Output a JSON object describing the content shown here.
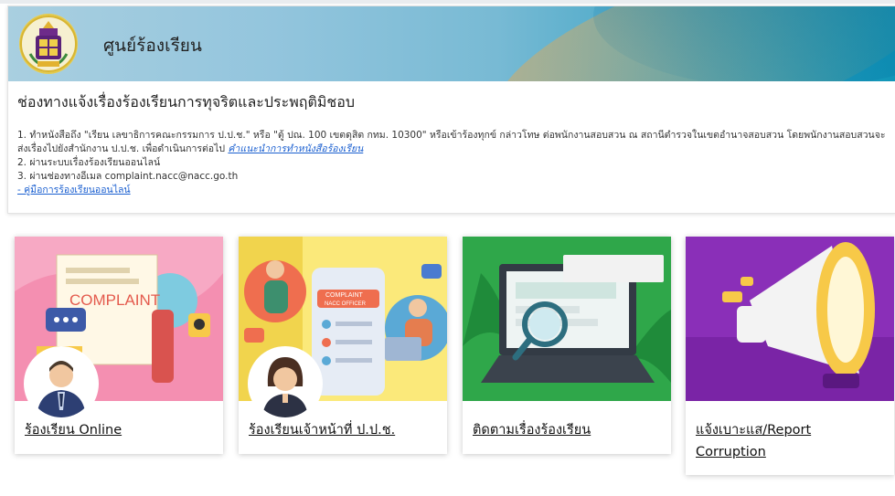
{
  "header": {
    "title": "ศูนย์ร้องเรียน",
    "logo_icon": "nacc-emblem-icon"
  },
  "intro": {
    "heading": "ช่องทางแจ้งเรื่องร้องเรียนการทุจริตและประพฤติมิชอบ",
    "line1": "1. ทำหนังสือถึง \"เรียน เลขาธิการคณะกรรมการ ป.ป.ช.\" หรือ \"ตู้ ปณ. 100 เขตดุสิต กทม. 10300\" หรือเข้าร้องทุกข์ กล่าวโทษ ต่อพนักงานสอบสวน ณ สถานีตำรวจในเขตอำนาจสอบสวน โดยพนักงานสอบสวนจะส่งเรื่องไปยังสำนักงาน ป.ป.ช. เพื่อดำเนินการต่อไป",
    "line1_link": "คำแนะนำการทำหนังสือร้องเรียน",
    "line2": "2. ผ่านระบบเรื่องร้องเรียนออนไลน์",
    "line3": "3. ผ่านช่องทางอีเมล complaint.nacc@nacc.go.th",
    "manual_link": "- คู่มือการร้องเรียนออนไลน์"
  },
  "cards": [
    {
      "label": "ร้องเรียน Online",
      "art_text": "COMPLAINT"
    },
    {
      "label": "ร้องเรียนเจ้าหน้าที่ ป.ป.ช.",
      "art_text_1": "COMPLAINT",
      "art_text_2": "NACC OFFICER"
    },
    {
      "label": "ติดตามเรื่องร้องเรียน"
    },
    {
      "label": "แจ้งเบาะแส/Report Corruption"
    }
  ]
}
